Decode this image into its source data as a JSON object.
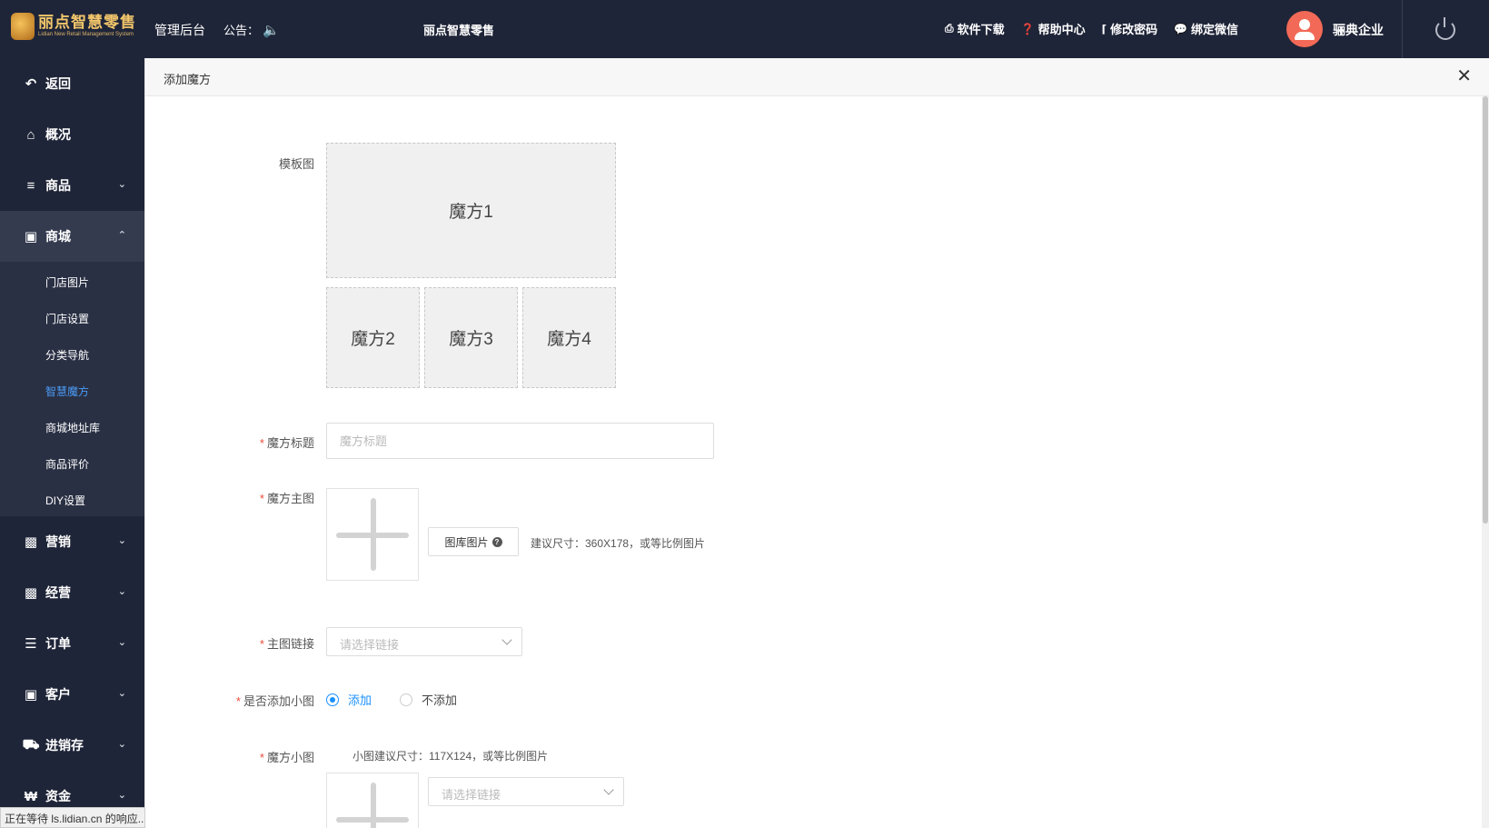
{
  "header": {
    "logo_title": "丽点智慧零售",
    "logo_subtitle": "Lidian New Retail Management System",
    "admin": "管理后台",
    "notice_label": "公告：",
    "center_text": "丽点智慧零售",
    "links": [
      {
        "label": "软件下载",
        "icon": "printer-icon"
      },
      {
        "label": "帮助中心",
        "icon": "question-icon"
      },
      {
        "label": "修改密码",
        "icon": "thermometer-icon"
      },
      {
        "label": "绑定微信",
        "icon": "wechat-icon"
      }
    ],
    "company": "骊典企业"
  },
  "sidebar": {
    "items": [
      {
        "label": "返回",
        "icon": "back-arrow-icon"
      },
      {
        "label": "概况",
        "icon": "home-icon"
      },
      {
        "label": "商品",
        "icon": "list-icon"
      },
      {
        "label": "商城",
        "icon": "shopping-bag-icon"
      },
      {
        "label": "营销",
        "icon": "gift-icon"
      },
      {
        "label": "经营",
        "icon": "bar-chart-icon"
      },
      {
        "label": "订单",
        "icon": "order-list-icon"
      },
      {
        "label": "客户",
        "icon": "id-card-icon"
      },
      {
        "label": "进销存",
        "icon": "truck-icon"
      },
      {
        "label": "资金",
        "icon": "won-icon"
      }
    ],
    "submenu": [
      {
        "label": "门店图片"
      },
      {
        "label": "门店设置"
      },
      {
        "label": "分类导航"
      },
      {
        "label": "智慧魔方"
      },
      {
        "label": "商城地址库"
      },
      {
        "label": "商品评价"
      },
      {
        "label": "DIY设置"
      }
    ]
  },
  "panel": {
    "title": "添加魔方",
    "template_label": "模板图",
    "cubes": [
      "魔方1",
      "魔方2",
      "魔方3",
      "魔方4"
    ],
    "title_label": "魔方标题",
    "title_placeholder": "魔方标题",
    "main_image_label": "魔方主图",
    "library_button": "图库图片",
    "main_size_hint": "建议尺寸：360X178，或等比例图片",
    "main_link_label": "主图链接",
    "link_placeholder": "请选择链接",
    "add_small_label": "是否添加小图",
    "radio_add": "添加",
    "radio_no_add": "不添加",
    "small_image_label": "魔方小图",
    "small_size_hint": "小图建议尺寸：117X124，或等比例图片"
  },
  "status_bar": "正在等待 ls.lidian.cn 的响应..."
}
